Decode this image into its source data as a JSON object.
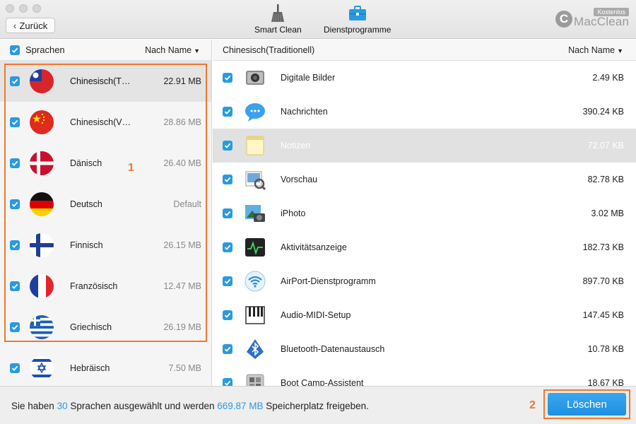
{
  "window": {
    "back_label": "Zurück",
    "toolbar": [
      {
        "label": "Smart Clean",
        "icon": "broom-icon"
      },
      {
        "label": "Dienstprogramme",
        "icon": "toolbox-icon"
      }
    ],
    "logo": {
      "badge": "Kostenlos",
      "letter": "C",
      "name": "MacClean"
    }
  },
  "left_panel": {
    "header_title": "Sprachen",
    "sort_label": "Nach Name",
    "languages": [
      {
        "name": "Chinesisch(T…",
        "size": "22.91 MB",
        "flag": "taiwan-flag-icon",
        "selected": true
      },
      {
        "name": "Chinesisch(V…",
        "size": "28.86 MB",
        "flag": "china-flag-icon",
        "selected": false
      },
      {
        "name": "Dänisch",
        "size": "26.40 MB",
        "flag": "denmark-flag-icon",
        "selected": false
      },
      {
        "name": "Deutsch",
        "size": "Default",
        "flag": "germany-flag-icon",
        "selected": false
      },
      {
        "name": "Finnisch",
        "size": "26.15 MB",
        "flag": "finland-flag-icon",
        "selected": false
      },
      {
        "name": "Französisch",
        "size": "12.47 MB",
        "flag": "france-flag-icon",
        "selected": false
      },
      {
        "name": "Griechisch",
        "size": "26.19 MB",
        "flag": "greece-flag-icon",
        "selected": false
      },
      {
        "name": "Hebräisch",
        "size": "7.50 MB",
        "flag": "israel-flag-icon",
        "selected": false
      }
    ]
  },
  "right_panel": {
    "header_title": "Chinesisch(Traditionell)",
    "sort_label": "Nach Name",
    "apps": [
      {
        "name": "Digitale Bilder",
        "size": "2.49 KB",
        "icon": "camera-scanner-icon",
        "selected": false
      },
      {
        "name": "Nachrichten",
        "size": "390.24 KB",
        "icon": "messages-icon",
        "selected": false
      },
      {
        "name": "Notizen",
        "size": "72.07 KB",
        "icon": "notes-icon",
        "selected": true
      },
      {
        "name": "Vorschau",
        "size": "82.78 KB",
        "icon": "preview-icon",
        "selected": false
      },
      {
        "name": "iPhoto",
        "size": "3.02 MB",
        "icon": "iphoto-icon",
        "selected": false
      },
      {
        "name": "Aktivitätsanzeige",
        "size": "182.73 KB",
        "icon": "activity-monitor-icon",
        "selected": false
      },
      {
        "name": "AirPort-Dienstprogramm",
        "size": "897.70 KB",
        "icon": "wifi-icon",
        "selected": false
      },
      {
        "name": "Audio-MIDI-Setup",
        "size": "147.45 KB",
        "icon": "piano-icon",
        "selected": false
      },
      {
        "name": "Bluetooth-Datenaustausch",
        "size": "10.78 KB",
        "icon": "bluetooth-icon",
        "selected": false
      },
      {
        "name": "Boot Camp-Assistent",
        "size": "18.67 KB",
        "icon": "boot-camp-icon",
        "selected": false
      }
    ]
  },
  "bottom": {
    "status_prefix": "Sie haben ",
    "language_count": "30",
    "status_middle": " Sprachen ausgewählt und werden ",
    "total_size": "669.87 MB",
    "status_suffix": " Speicherplatz freigeben.",
    "delete_label": "Löschen"
  },
  "annotations": {
    "one": "1",
    "two": "2"
  },
  "colors": {
    "accent": "#2a9ae0",
    "annotation": "#f0782d"
  }
}
